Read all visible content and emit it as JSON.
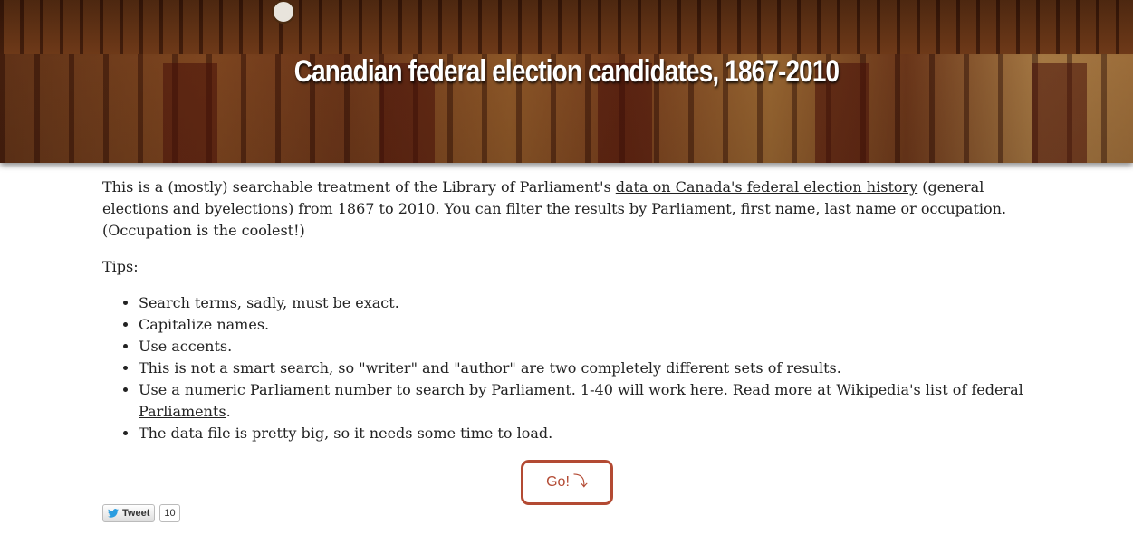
{
  "header": {
    "title": "Canadian federal election candidates, 1867-2010"
  },
  "intro": {
    "text_before_link": "This is a (mostly) searchable treatment of the Library of Parliament's ",
    "link_text": "data on Canada's federal election history",
    "text_after_link": " (general elections and byelections) from 1867 to 2010. You can filter the results by Parliament, first name, last name or occupation. (Occupation is the coolest!)"
  },
  "tips": {
    "heading": "Tips:",
    "items": [
      "Search terms, sadly, must be exact.",
      "Capitalize names.",
      "Use accents.",
      "This is not a smart search, so \"writer\" and \"author\" are two completely different sets of results."
    ],
    "parliament_tip": {
      "text_before_link": "Use a numeric Parliament number to search by Parliament. 1-40 will work here. Read more at ",
      "link_text": "Wikipedia's list of federal Parliaments",
      "text_after_link": "."
    },
    "last_item": "The data file is pretty big, so it needs some time to load."
  },
  "go_button": {
    "label": "Go!",
    "arrow": "⤵"
  },
  "tweet": {
    "label": "Tweet",
    "count": "10"
  },
  "colors": {
    "accent": "#b34a33",
    "text": "#222222"
  }
}
